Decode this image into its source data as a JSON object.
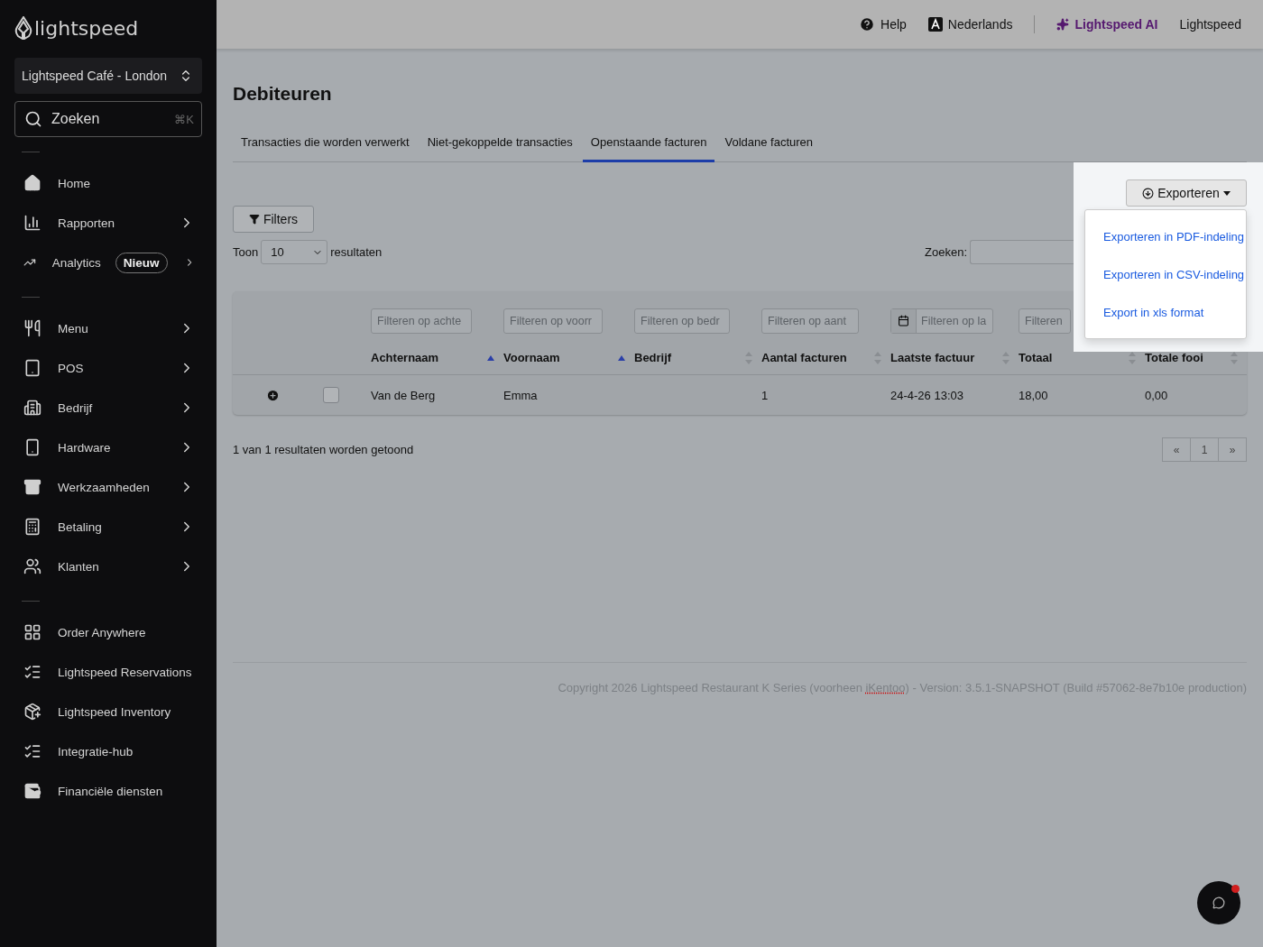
{
  "sidebar": {
    "logo": "lightspeed",
    "store": "Lightspeed Café - London",
    "search": {
      "placeholder": "Zoeken",
      "shortcut": "⌘K"
    },
    "groups": [
      [
        {
          "label": "Home",
          "chevron": false
        },
        {
          "label": "Rapporten",
          "chevron": true
        },
        {
          "label": "Analytics",
          "chevron": true,
          "badge": "Nieuw"
        }
      ],
      [
        {
          "label": "Menu",
          "chevron": true
        },
        {
          "label": "POS",
          "chevron": true
        },
        {
          "label": "Bedrijf",
          "chevron": true
        },
        {
          "label": "Hardware",
          "chevron": true
        },
        {
          "label": "Werkzaamheden",
          "chevron": true
        },
        {
          "label": "Betaling",
          "chevron": true
        },
        {
          "label": "Klanten",
          "chevron": true
        }
      ],
      [
        {
          "label": "Order Anywhere",
          "chevron": false
        },
        {
          "label": "Lightspeed Reservations",
          "chevron": false
        },
        {
          "label": "Lightspeed Inventory",
          "chevron": false
        },
        {
          "label": "Integratie-hub",
          "chevron": false
        },
        {
          "label": "Financiële diensten",
          "chevron": false
        }
      ]
    ]
  },
  "topbar": [
    {
      "label": "Help",
      "kind": "help"
    },
    {
      "label": "Nederlands",
      "kind": "lang"
    },
    {
      "label": "Lightspeed AI",
      "kind": "ai"
    },
    {
      "label": "Lightspeed",
      "kind": "plain"
    }
  ],
  "title": "Debiteuren",
  "tabs": [
    {
      "label": "Transacties die worden verwerkt",
      "selected": false
    },
    {
      "label": "Niet-gekoppelde transacties",
      "selected": false
    },
    {
      "label": "Openstaande facturen",
      "selected": true
    },
    {
      "label": "Voldane facturen",
      "selected": false
    }
  ],
  "export": {
    "label": "Exporteren",
    "menu": [
      "Exporteren in PDF-indeling",
      "Exporteren in CSV-indeling",
      "Export in xls format"
    ]
  },
  "filters_button": "Filters",
  "show": {
    "before": "Toon",
    "value": "10",
    "after": "resultaten"
  },
  "search_label": "Zoeken:",
  "table": {
    "columns": [
      {
        "label": "Achternaam",
        "filter": "Filteren op achte",
        "sorted": true
      },
      {
        "label": "Voornaam",
        "filter": "Filteren op voorr",
        "sorted": true
      },
      {
        "label": "Bedrijf",
        "filter": "Filteren op bedr",
        "sorted": false
      },
      {
        "label": "Aantal facturen",
        "filter": "Filteren op aant",
        "sorted": false
      },
      {
        "label": "Laatste factuur",
        "filter": "Filteren op la",
        "sorted": false,
        "kind": "date"
      },
      {
        "label": "Totaal",
        "filter": "Filteren",
        "sorted": false,
        "kind": "text"
      },
      {
        "label": "Totale fooi",
        "sorted": false
      }
    ],
    "rows": [
      {
        "checked": false,
        "cells": [
          "Van de Berg",
          "Emma",
          "",
          "1",
          "24-4-26 13:03",
          "18,00",
          "0,00"
        ]
      }
    ]
  },
  "summary": "1 van 1 resultaten worden getoond",
  "pagination": [
    {
      "label": "«",
      "selected": false
    },
    {
      "label": "1",
      "selected": false
    },
    {
      "label": "»",
      "selected": false
    }
  ],
  "copyright": {
    "before": "Copyright 2026 Lightspeed Restaurant K Series (voorheen ",
    "flagged": "iKentoo",
    "after": ") - Version: 3.5.1-SNAPSHOT (Build #57062-8e7b10e production)"
  },
  "chat": {
    "unread": true
  }
}
